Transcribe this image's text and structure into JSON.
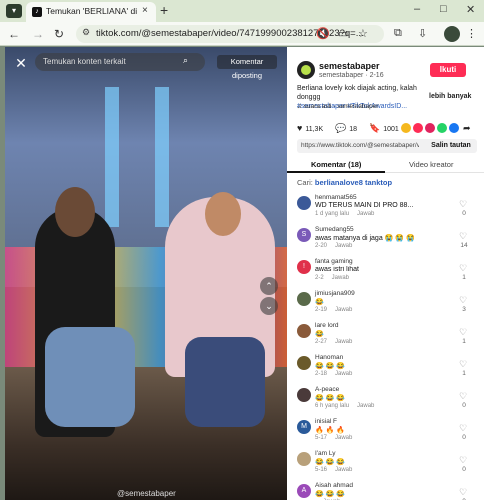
{
  "browser": {
    "tab_title": "Temukan 'BERLIANA' di TikTok",
    "tab_close": "×",
    "tab_add": "+",
    "url": "tiktok.com/@semestabaper/video/7471999002381274423?q=...",
    "win_min": "–",
    "win_max": "□",
    "win_close": "✕"
  },
  "video": {
    "close": "✕",
    "search_placeholder": "Temukan konten terkait",
    "report_label": "Komentar diposting",
    "nav_up": "⌃",
    "nav_down": "⌄",
    "caption": "@semestabaper"
  },
  "panel": {
    "username": "semestabaper",
    "subline": "semestabaper · 2-16",
    "follow_label": "Ikuti",
    "description": "Berliana lovely kok diajak acting, kalah donggg",
    "hashtags": "#semestabaper #TikTokAwardsID...",
    "more_label": "lebih banyak",
    "music": "♫ suara asli - semestabaper",
    "stats": {
      "likes": "11,3K",
      "comments": "18",
      "saves": "1001"
    },
    "link": "https://www.tiktok.com/@semestabaper/video/7471999...",
    "copy_label": "Salin tautan",
    "tab_comments": "Komentar (18)",
    "tab_creator": "Video kreator",
    "find_prefix": "Cari: ",
    "find_keyword": "berlianalove8 tanktop",
    "reply_label": "Jawab",
    "comments": [
      {
        "user": "henmamat565",
        "text": "WD TERUS MAIN DI PRO 88...",
        "meta": "1 d yang lalu",
        "likes": "0",
        "color": "#3b5998",
        "initial": ""
      },
      {
        "user": "Sumedang55",
        "text": "awas matanya di jaga 😭 😭 😭",
        "meta": "2-20",
        "likes": "14",
        "color": "#7a5ab8",
        "initial": "S"
      },
      {
        "user": "fanta gaming",
        "text": "awas istri lihat",
        "meta": "2-2",
        "likes": "1",
        "color": "#e0304a",
        "initial": "!"
      },
      {
        "user": "jimiusjana909",
        "text": "😂",
        "meta": "2-19",
        "likes": "3",
        "color": "#5a6a4a",
        "initial": ""
      },
      {
        "user": "lare lord",
        "text": "😂",
        "meta": "2-27",
        "likes": "1",
        "color": "#8a5a3a",
        "initial": ""
      },
      {
        "user": "Hanoman",
        "text": "😂 😂 😂",
        "meta": "2-18",
        "likes": "1",
        "color": "#6a5a2a",
        "initial": ""
      },
      {
        "user": "A-peace",
        "text": "😂 😂 😂",
        "meta": "6 h yang lalu",
        "likes": "0",
        "color": "#4a3a3a",
        "initial": ""
      },
      {
        "user": "inisial F",
        "text": "🔥 🔥 🔥",
        "meta": "5-17",
        "likes": "0",
        "color": "#2a5a9a",
        "initial": "M"
      },
      {
        "user": "I'am Ly",
        "text": "😂 😂 😂",
        "meta": "5-16",
        "likes": "0",
        "color": "#b8a07a",
        "initial": ""
      },
      {
        "user": "Aisah ahmad",
        "text": "😂 😂 😂",
        "meta": "",
        "likes": "0",
        "color": "#9a4ab8",
        "initial": "A"
      }
    ]
  }
}
